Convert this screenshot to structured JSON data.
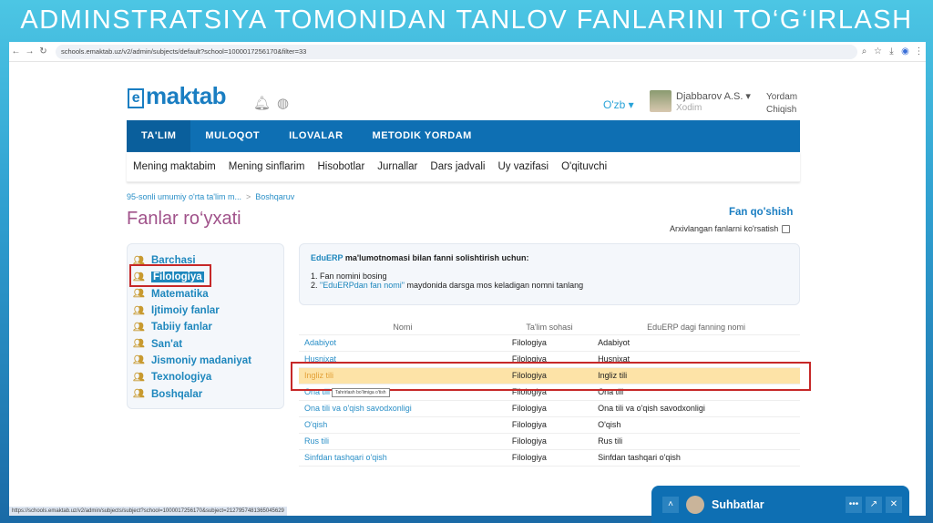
{
  "slide_title": "ADMINSTRATSIYA TOMONIDAN TANLOV FANLARINI TO‘G‘IRLASH",
  "browser": {
    "url": "schools.emaktab.uz/v2/admin/subjects/default?school=1000017256170&filter=33",
    "status_url": "https://schools.emaktab.uz/v2/admin/subjects/subject?school=1000017256170&subject=2127957481365045629"
  },
  "header": {
    "logo": "maktab",
    "lang": "O'zb",
    "user_name": "Djabbarov A.S.",
    "user_role": "Xodim",
    "help": "Yordam",
    "logout": "Chiqish"
  },
  "nav": [
    "TA'LIM",
    "MULOQOT",
    "ILOVALAR",
    "METODIK YORDAM"
  ],
  "subnav": [
    "Mening maktabim",
    "Mening sinflarim",
    "Hisobotlar",
    "Jurnallar",
    "Dars jadvali",
    "Uy vazifasi",
    "O'qituvchi"
  ],
  "breadcrumb": [
    "95-sonli umumiy o'rta ta'lim m...",
    "Boshqaruv"
  ],
  "page_title": "Fanlar ro‘yxati",
  "add_subject": "Fan qo'shish",
  "archive_label": "Arxivlangan fanlarni ko'rsatish",
  "categories": [
    "Barchasi",
    "Filologiya",
    "Matematika",
    "Ijtimoiy fanlar",
    "Tabiiy fanlar",
    "San'at",
    "Jismoniy madaniyat",
    "Texnologiya",
    "Boshqalar"
  ],
  "info": {
    "brand": "EduERP",
    "title_rest": " ma'lumotnomasi bilan fanni solishtirish uchun:",
    "step1": "1. Fan nomini bosing",
    "step2_num": "2. ",
    "step2_link": "\"EduERPdan fan nomi\"",
    "step2_rest": " maydonida darsga mos keladigan nomni tanlang"
  },
  "table": {
    "headers": [
      "Nomi",
      "Ta'lim sohasi",
      "EduERP dagi fanning nomi"
    ],
    "rows": [
      [
        "Adabiyot",
        "Filologiya",
        "Adabiyot"
      ],
      [
        "Husnixat",
        "Filologiya",
        "Husnixat"
      ],
      [
        "Ingliz tili",
        "Filologiya",
        "Ingliz tili"
      ],
      [
        "Ona tili",
        "Filologiya",
        "Ona tili"
      ],
      [
        "Ona tili va o'qish savodxonligi",
        "Filologiya",
        "Ona tili va o'qish savodxonligi"
      ],
      [
        "O'qish",
        "Filologiya",
        "O'qish"
      ],
      [
        "Rus tili",
        "Filologiya",
        "Rus tili"
      ],
      [
        "Sinfdan tashqari o'qish",
        "Filologiya",
        "Sinfdan tashqari o'qish"
      ]
    ]
  },
  "tooltip": "Tahrirlash bo'limiga o'tish",
  "chat": {
    "title": "Suhbatlar"
  }
}
